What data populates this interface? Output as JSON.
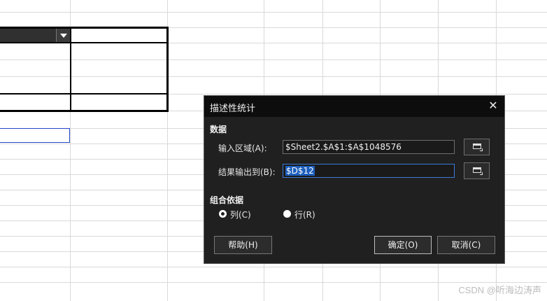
{
  "dialog": {
    "title": "描述性统计",
    "close_glyph": "✕",
    "data_section": "数据",
    "input_label": "输入区域(A):",
    "input_value": "$Sheet2.$A$1:$A$1048576",
    "output_label": "结果输出到(B):",
    "output_value": "$D$12",
    "group_section": "组合依据",
    "radio_col": "列(C)",
    "radio_row": "行(R)",
    "selected_grouping": "列(C)",
    "help_button": "帮助(H)",
    "ok_button": "确定(O)",
    "cancel_button": "取消(C)",
    "shrink_icon": "shrink-range-icon"
  },
  "watermark": "CSDN @听海边涛声",
  "colors": {
    "dialog_bg": "#202020",
    "titlebar_bg": "#0d0d0d",
    "selection_border": "#2447c9",
    "text_highlight": "#1d5fbd"
  }
}
